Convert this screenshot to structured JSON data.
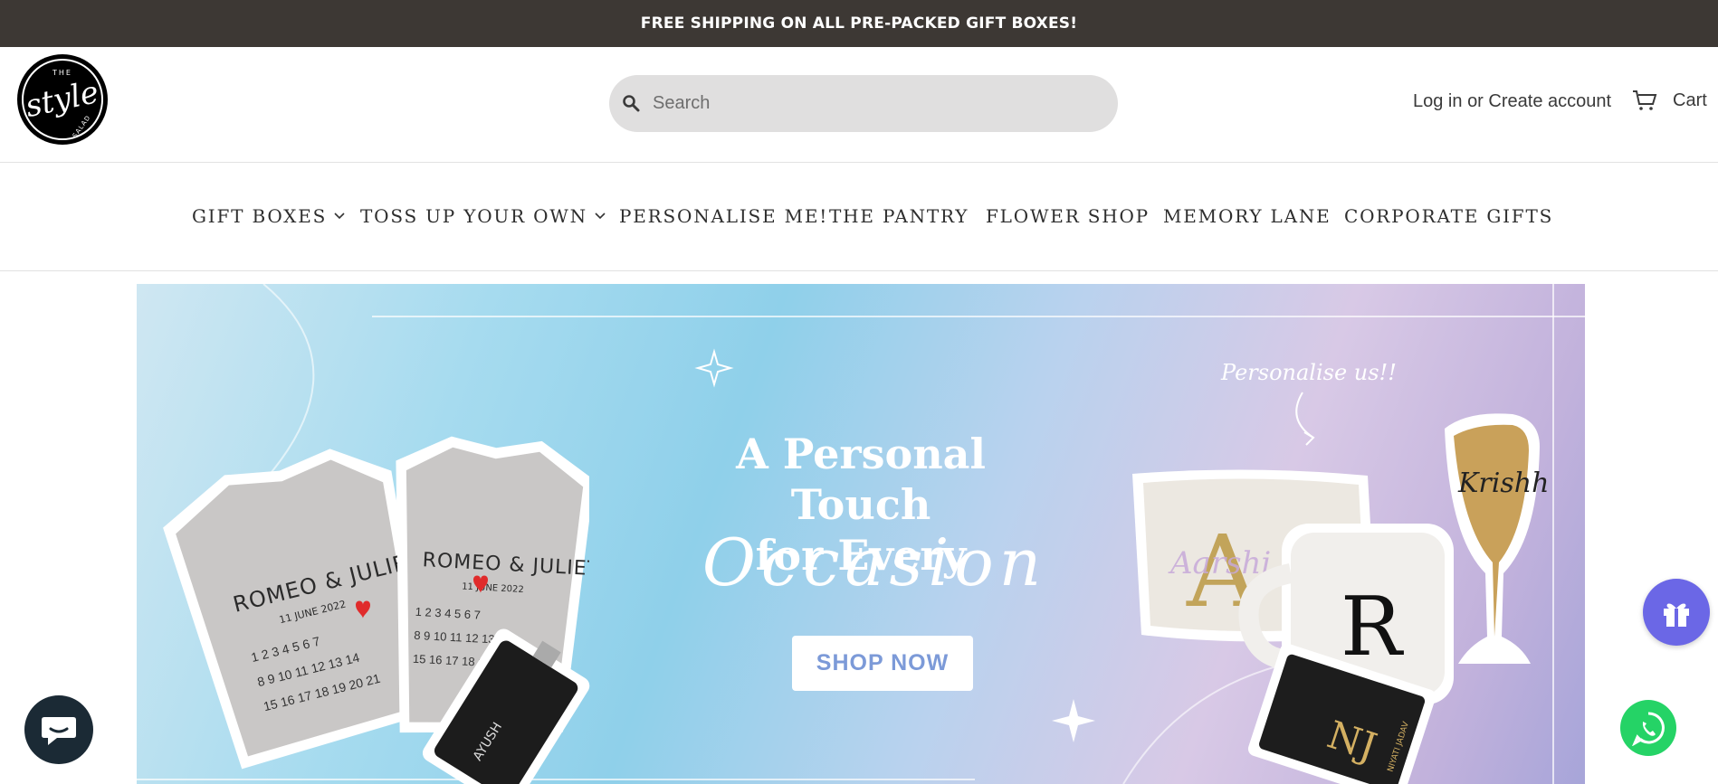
{
  "announcement": {
    "text": "FREE SHIPPING ON ALL PRE-PACKED GIFT BOXES!"
  },
  "logo": {
    "alt": "The Style Salad",
    "line1": "THE",
    "line2": "style",
    "line3": "SALAD"
  },
  "search": {
    "placeholder": "Search",
    "value": "",
    "icon": "search-icon"
  },
  "account": {
    "login_label": "Log in",
    "separator": "or",
    "create_label": "Create account"
  },
  "cart": {
    "label": "Cart",
    "icon": "cart-icon"
  },
  "nav": {
    "items": [
      {
        "label": "GIFT BOXES",
        "dropdown": true
      },
      {
        "label": "TOSS UP YOUR OWN",
        "dropdown": true
      },
      {
        "label": "PERSONALISE ME!",
        "dropdown": false
      },
      {
        "label": "THE PANTRY",
        "dropdown": false
      },
      {
        "label": "FLOWER SHOP",
        "dropdown": false
      },
      {
        "label": "MEMORY LANE",
        "dropdown": false
      },
      {
        "label": "CORPORATE GIFTS",
        "dropdown": false
      }
    ]
  },
  "hero": {
    "title_line1": "A Personal Touch",
    "title_line2": "for Every",
    "script_word": "Occasion",
    "cta_label": "SHOP NOW",
    "side_note": "Personalise us!!",
    "tshirt_text": "ROMEO & JULIET",
    "tshirt_date": "11 JUNE 2022",
    "flask_name": "AYUSH",
    "pouch_letter": "A",
    "pouch_name": "Aarshi",
    "mug_letter": "R",
    "glass_name": "Krishh",
    "card_monogram": "NJ",
    "card_name": "NIYATI JADAV"
  },
  "floating": {
    "rewards_icon": "gift-icon",
    "whatsapp_icon": "whatsapp-icon",
    "chat_icon": "chat-bubble-icon"
  },
  "colors": {
    "announcement_bg": "#3d3834",
    "search_bg": "#e0dfdf",
    "cta_text": "#7c9ad8",
    "rewards_bg": "#6b67e6",
    "whatsapp_bg": "#25d366",
    "chat_bg": "#1b2a35"
  }
}
